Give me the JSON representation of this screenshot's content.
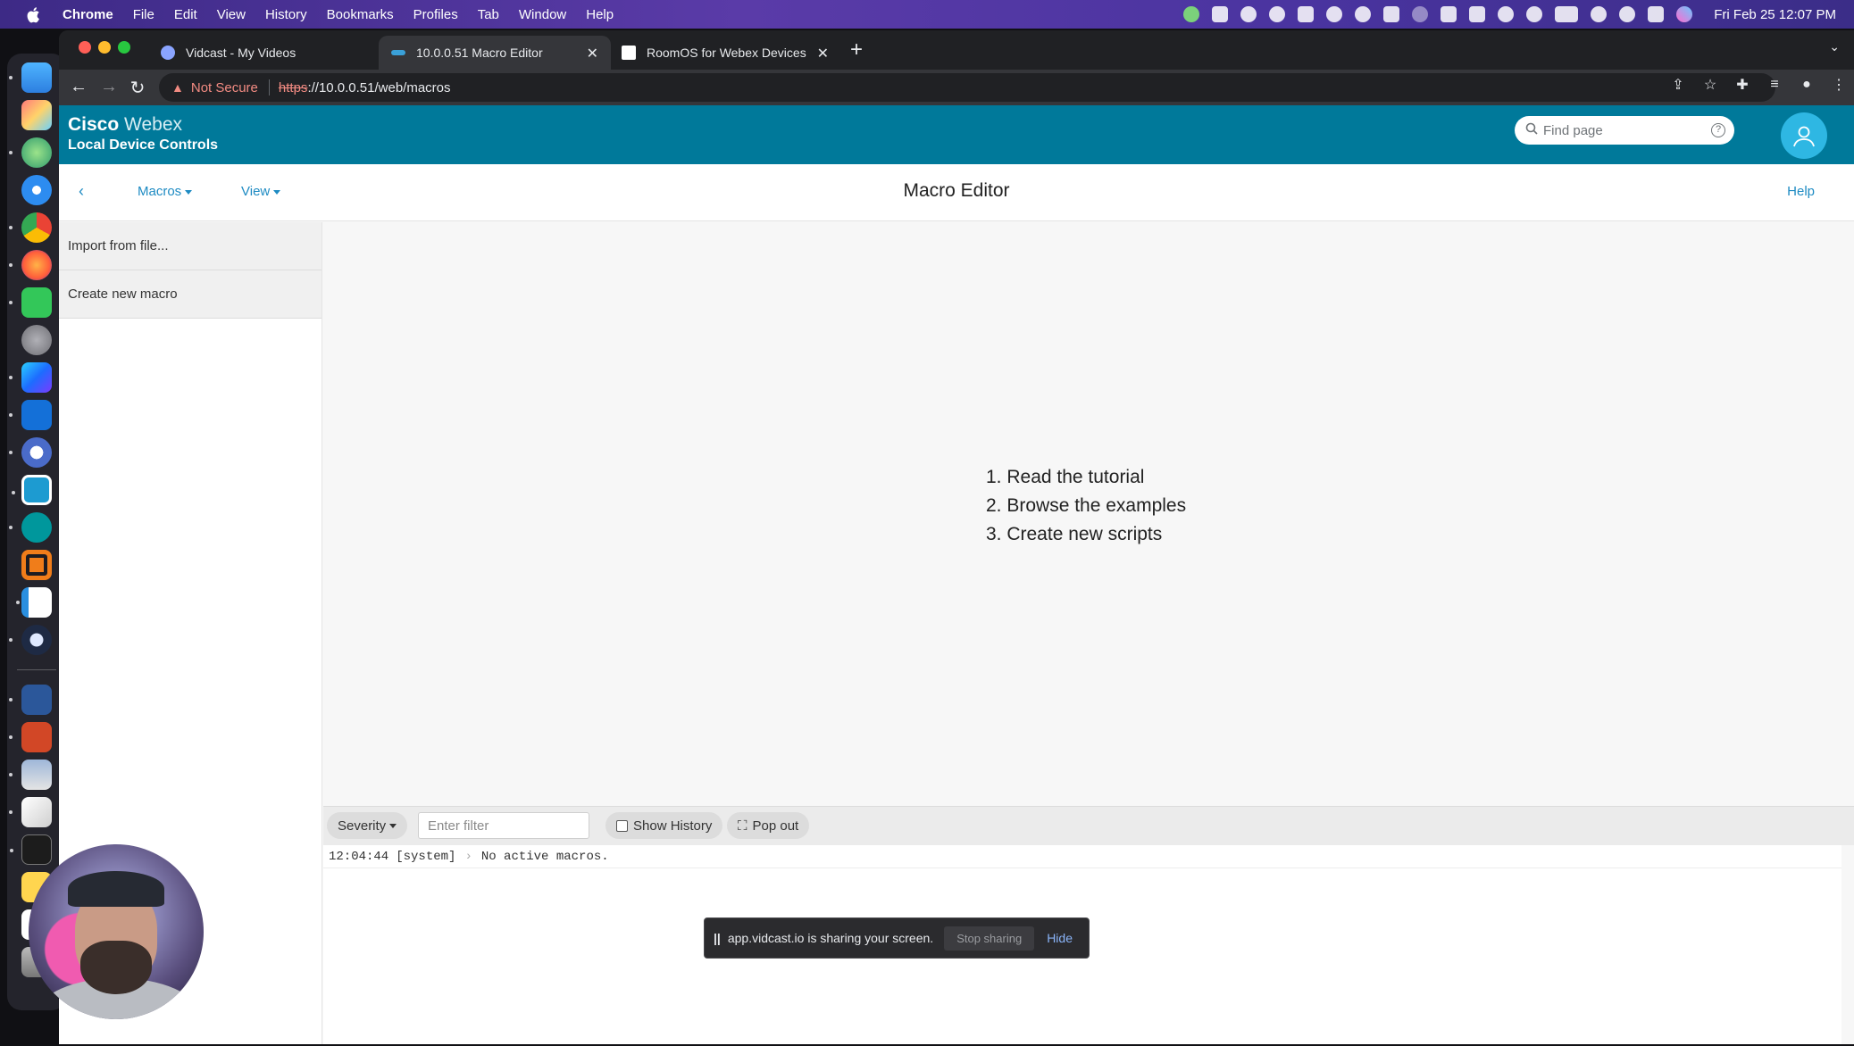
{
  "menubar": {
    "app": "Chrome",
    "items": [
      "File",
      "Edit",
      "View",
      "History",
      "Bookmarks",
      "Profiles",
      "Tab",
      "Window",
      "Help"
    ],
    "clock": "Fri Feb 25  12:07 PM"
  },
  "browser": {
    "tabs": [
      {
        "title": "Vidcast - My Videos"
      },
      {
        "title": "10.0.0.51 Macro Editor"
      },
      {
        "title": "RoomOS for Webex Devices"
      }
    ],
    "security": "Not Secure",
    "url_scheme": "https",
    "url_rest": "://10.0.0.51/web/macros"
  },
  "header": {
    "brand_cisco": "Cisco",
    "brand_webex": " Webex",
    "subtitle": "Local Device Controls",
    "search_placeholder": "Find page"
  },
  "subnav": {
    "macros": "Macros",
    "view": "View",
    "title": "Macro Editor",
    "help": "Help"
  },
  "sidebar": {
    "items": [
      {
        "label": "Import from file..."
      },
      {
        "label": "Create new macro"
      }
    ]
  },
  "editor": {
    "steps": [
      "1. Read the tutorial",
      "2. Browse the examples",
      "3. Create new scripts"
    ]
  },
  "console": {
    "severity": "Severity",
    "filter_placeholder": "Enter filter",
    "show_history": "Show History",
    "pop_out": "Pop out",
    "logs": [
      {
        "time": "12:04:44",
        "source": "[system]",
        "sep": "›",
        "message": "No active macros."
      }
    ]
  },
  "share_bar": {
    "pause": "||",
    "message": "app.vidcast.io is sharing your screen.",
    "stop": "Stop sharing",
    "hide": "Hide"
  },
  "colors": {
    "header": "#00799a",
    "link": "#1e8bc3",
    "menubar": "#4a34a0"
  }
}
